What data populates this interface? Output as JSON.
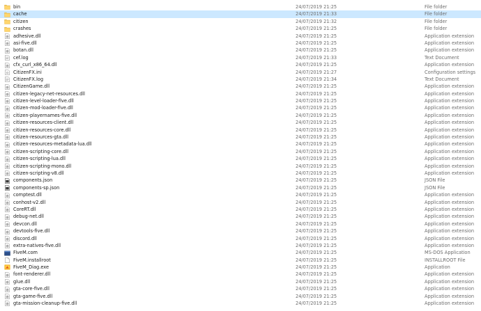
{
  "rows": [
    {
      "name": "bin",
      "date": "24/07/2019 21:25",
      "type": "File folder",
      "icon": "folder-icon"
    },
    {
      "name": "cache",
      "date": "24/07/2019 21:33",
      "type": "File folder",
      "icon": "folder-icon",
      "selected": true
    },
    {
      "name": "citizen",
      "date": "24/07/2019 21:32",
      "type": "File folder",
      "icon": "folder-icon"
    },
    {
      "name": "crashes",
      "date": "24/07/2019 21:25",
      "type": "File folder",
      "icon": "folder-icon"
    },
    {
      "name": "adhesive.dll",
      "date": "24/07/2019 21:25",
      "type": "Application extension",
      "icon": "dll-file-icon"
    },
    {
      "name": "asi-five.dll",
      "date": "24/07/2019 21:25",
      "type": "Application extension",
      "icon": "dll-file-icon"
    },
    {
      "name": "botan.dll",
      "date": "24/07/2019 21:25",
      "type": "Application extension",
      "icon": "dll-file-icon"
    },
    {
      "name": "cef.log",
      "date": "24/07/2019 21:33",
      "type": "Text Document",
      "icon": "text-file-icon"
    },
    {
      "name": "cfx_curl_x86_64.dll",
      "date": "24/07/2019 21:25",
      "type": "Application extension",
      "icon": "dll-file-icon"
    },
    {
      "name": "CitizenFX.ini",
      "date": "24/07/2019 21:27",
      "type": "Configuration settings",
      "icon": "ini-file-icon"
    },
    {
      "name": "CitizenFX.log",
      "date": "24/07/2019 21:34",
      "type": "Text Document",
      "icon": "text-file-icon"
    },
    {
      "name": "CitizenGame.dll",
      "date": "24/07/2019 21:25",
      "type": "Application extension",
      "icon": "dll-file-icon"
    },
    {
      "name": "citizen-legacy-net-resources.dll",
      "date": "24/07/2019 21:25",
      "type": "Application extension",
      "icon": "dll-file-icon"
    },
    {
      "name": "citizen-level-loader-five.dll",
      "date": "24/07/2019 21:25",
      "type": "Application extension",
      "icon": "dll-file-icon"
    },
    {
      "name": "citizen-mod-loader-five.dll",
      "date": "24/07/2019 21:25",
      "type": "Application extension",
      "icon": "dll-file-icon"
    },
    {
      "name": "citizen-playernames-five.dll",
      "date": "24/07/2019 21:25",
      "type": "Application extension",
      "icon": "dll-file-icon"
    },
    {
      "name": "citizen-resources-client.dll",
      "date": "24/07/2019 21:25",
      "type": "Application extension",
      "icon": "dll-file-icon"
    },
    {
      "name": "citizen-resources-core.dll",
      "date": "24/07/2019 21:25",
      "type": "Application extension",
      "icon": "dll-file-icon"
    },
    {
      "name": "citizen-resources-gta.dll",
      "date": "24/07/2019 21:25",
      "type": "Application extension",
      "icon": "dll-file-icon"
    },
    {
      "name": "citizen-resources-metadata-lua.dll",
      "date": "24/07/2019 21:25",
      "type": "Application extension",
      "icon": "dll-file-icon"
    },
    {
      "name": "citizen-scripting-core.dll",
      "date": "24/07/2019 21:25",
      "type": "Application extension",
      "icon": "dll-file-icon"
    },
    {
      "name": "citizen-scripting-lua.dll",
      "date": "24/07/2019 21:25",
      "type": "Application extension",
      "icon": "dll-file-icon"
    },
    {
      "name": "citizen-scripting-mono.dll",
      "date": "24/07/2019 21:25",
      "type": "Application extension",
      "icon": "dll-file-icon"
    },
    {
      "name": "citizen-scripting-v8.dll",
      "date": "24/07/2019 21:25",
      "type": "Application extension",
      "icon": "dll-file-icon"
    },
    {
      "name": "components.json",
      "date": "24/07/2019 21:25",
      "type": "JSON File",
      "icon": "json-file-icon"
    },
    {
      "name": "components-sp.json",
      "date": "24/07/2019 21:25",
      "type": "JSON File",
      "icon": "json-file-icon"
    },
    {
      "name": "comptest.dll",
      "date": "24/07/2019 21:25",
      "type": "Application extension",
      "icon": "dll-file-icon"
    },
    {
      "name": "conhost-v2.dll",
      "date": "24/07/2019 21:25",
      "type": "Application extension",
      "icon": "dll-file-icon"
    },
    {
      "name": "CoreRT.dll",
      "date": "24/07/2019 21:25",
      "type": "Application extension",
      "icon": "dll-file-icon"
    },
    {
      "name": "debug-net.dll",
      "date": "24/07/2019 21:25",
      "type": "Application extension",
      "icon": "dll-file-icon"
    },
    {
      "name": "devcon.dll",
      "date": "24/07/2019 21:25",
      "type": "Application extension",
      "icon": "dll-file-icon"
    },
    {
      "name": "devtools-five.dll",
      "date": "24/07/2019 21:25",
      "type": "Application extension",
      "icon": "dll-file-icon"
    },
    {
      "name": "discord.dll",
      "date": "24/07/2019 21:25",
      "type": "Application extension",
      "icon": "dll-file-icon"
    },
    {
      "name": "extra-natives-five.dll",
      "date": "24/07/2019 21:25",
      "type": "Application extension",
      "icon": "dll-file-icon"
    },
    {
      "name": "FiveM.com",
      "date": "24/07/2019 21:25",
      "type": "MS-DOS Application",
      "icon": "msdos-app-icon"
    },
    {
      "name": "FiveM.installroot",
      "date": "24/07/2019 21:25",
      "type": "INSTALLROOT File",
      "icon": "generic-file-icon"
    },
    {
      "name": "FiveM_Diag.exe",
      "date": "24/07/2019 21:25",
      "type": "Application",
      "icon": "exe-app-icon"
    },
    {
      "name": "font-renderer.dll",
      "date": "24/07/2019 21:25",
      "type": "Application extension",
      "icon": "dll-file-icon"
    },
    {
      "name": "glue.dll",
      "date": "24/07/2019 21:25",
      "type": "Application extension",
      "icon": "dll-file-icon"
    },
    {
      "name": "gta-core-five.dll",
      "date": "24/07/2019 21:25",
      "type": "Application extension",
      "icon": "dll-file-icon"
    },
    {
      "name": "gta-game-five.dll",
      "date": "24/07/2019 21:25",
      "type": "Application extension",
      "icon": "dll-file-icon"
    },
    {
      "name": "gta-mission-cleanup-five.dll",
      "date": "24/07/2019 21:25",
      "type": "Application extension",
      "icon": "dll-file-icon"
    }
  ],
  "colors": {
    "selection": "#cce8ff",
    "folder": "#f4c95d",
    "secondary_text": "#6d6d6d"
  }
}
